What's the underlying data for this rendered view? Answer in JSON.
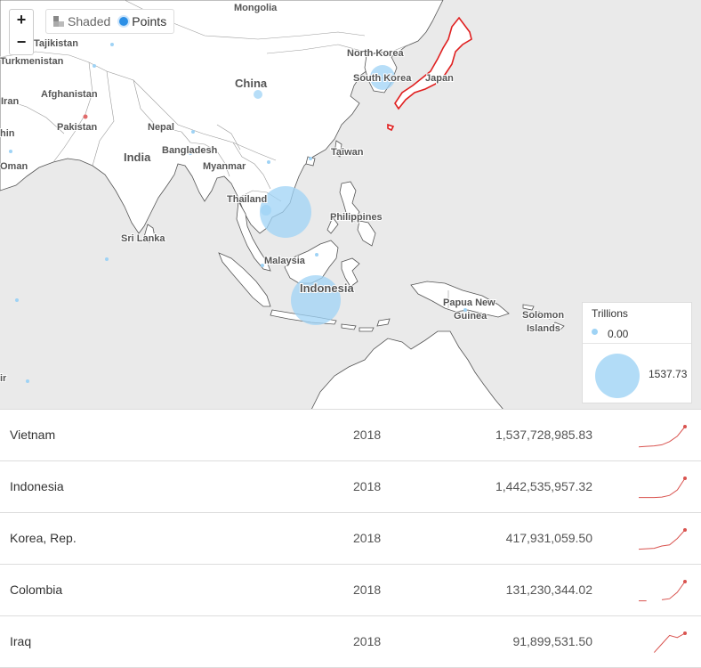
{
  "map": {
    "controls": {
      "zoom_in": "+",
      "zoom_out": "−"
    },
    "mode_toggle": {
      "shaded_label": "Shaded",
      "points_label": "Points",
      "selected": "Points"
    },
    "highlight_color": "#e02020",
    "bubble_color": "#9fd3f5",
    "labels": {
      "mongolia": "Mongolia",
      "tajikistan": "Tajikistan",
      "turkmenistan": "Turkmenistan",
      "afghanistan": "Afghanistan",
      "iran": "Iran",
      "pakistan": "Pakistan",
      "nepal": "Nepal",
      "china": "China",
      "north_korea": "North Korea",
      "south_korea": "South Korea",
      "japan": "Japan",
      "india": "India",
      "bangladesh": "Bangladesh",
      "myanmar": "Myanmar",
      "oman": "Oman",
      "taiwan": "Taiwan",
      "thailand": "Thailand",
      "philippines": "Philippines",
      "sri_lanka": "Sri Lanka",
      "malaysia": "Malaysia",
      "indonesia": "Indonesia",
      "papua_new_guinea_1": "Papua New",
      "papua_new_guinea_2": "Guinea",
      "solomon_islands_1": "Solomon",
      "solomon_islands_2": "Islands",
      "edge_ir": "ir",
      "edge_hin": "hin"
    },
    "legend": {
      "title": "Trillions",
      "min": "0.00",
      "max": "1537.73"
    }
  },
  "table": {
    "rows": [
      {
        "country": "Vietnam",
        "year": "2018",
        "value": "1,537,728,985.83",
        "trend": [
          0.05,
          0.08,
          0.1,
          0.15,
          0.3,
          0.55,
          1.0
        ]
      },
      {
        "country": "Indonesia",
        "year": "2018",
        "value": "1,442,535,957.32",
        "trend": [
          0.1,
          0.1,
          0.1,
          0.12,
          0.2,
          0.45,
          1.0
        ]
      },
      {
        "country": "Korea, Rep.",
        "year": "2018",
        "value": "417,931,059.50",
        "trend": [
          0.1,
          0.12,
          0.14,
          0.25,
          0.3,
          0.6,
          1.0
        ]
      },
      {
        "country": "Colombia",
        "year": "2018",
        "value": "131,230,344.02",
        "trend": [
          0.1,
          0.1,
          null,
          0.15,
          0.2,
          0.5,
          1.0
        ]
      },
      {
        "country": "Iraq",
        "year": "2018",
        "value": "91,899,531.50",
        "trend": [
          0.1,
          null,
          0.1,
          0.5,
          0.9,
          0.8,
          1.0
        ]
      }
    ]
  }
}
